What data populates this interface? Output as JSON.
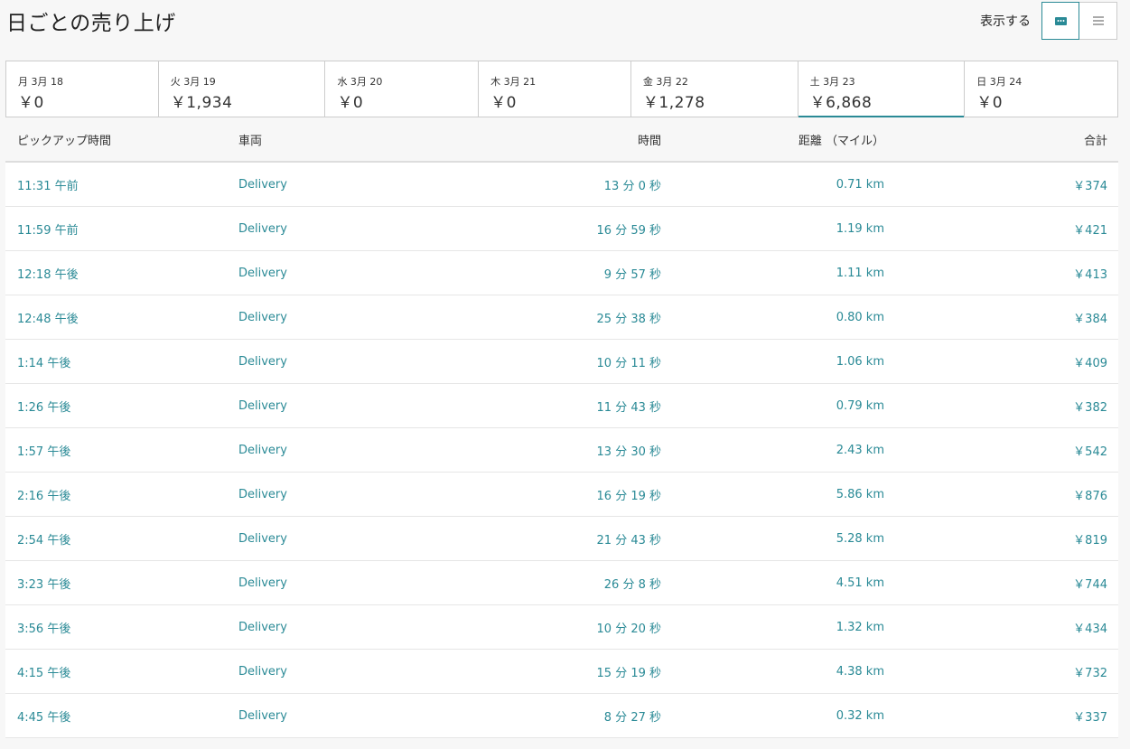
{
  "header": {
    "title": "日ごとの売り上げ",
    "view_label": "表示する",
    "view_options": [
      {
        "icon": "tile-view-icon",
        "active": true
      },
      {
        "icon": "list-view-icon",
        "active": false
      }
    ]
  },
  "days": [
    {
      "label": "月 3月 18",
      "amount": "￥0",
      "width": 169
    },
    {
      "label": "火 3月 19",
      "amount": "￥1,934",
      "width": 185
    },
    {
      "label": "水 3月 20",
      "amount": "￥0",
      "width": 170
    },
    {
      "label": "木 3月 21",
      "amount": "￥0",
      "width": 169
    },
    {
      "label": "金 3月 22",
      "amount": "￥1,278",
      "width": 185
    },
    {
      "label": "土 3月 23",
      "amount": "￥6,868",
      "width": 185,
      "active": true
    },
    {
      "label": "日 3月 24",
      "amount": "￥0",
      "width": 169
    }
  ],
  "table": {
    "headers": [
      "ピックアップ時間",
      "車両",
      "時間",
      "距離 （マイル）",
      "合計"
    ],
    "rows": [
      [
        "11:31 午前",
        "Delivery",
        "13 分 0 秒",
        "0.71 km",
        "￥374"
      ],
      [
        "11:59 午前",
        "Delivery",
        "16 分 59 秒",
        "1.19 km",
        "￥421"
      ],
      [
        "12:18 午後",
        "Delivery",
        "9 分 57 秒",
        "1.11 km",
        "￥413"
      ],
      [
        "12:48 午後",
        "Delivery",
        "25 分 38 秒",
        "0.80 km",
        "￥384"
      ],
      [
        "1:14 午後",
        "Delivery",
        "10 分 11 秒",
        "1.06 km",
        "￥409"
      ],
      [
        "1:26 午後",
        "Delivery",
        "11 分 43 秒",
        "0.79 km",
        "￥382"
      ],
      [
        "1:57 午後",
        "Delivery",
        "13 分 30 秒",
        "2.43 km",
        "￥542"
      ],
      [
        "2:16 午後",
        "Delivery",
        "16 分 19 秒",
        "5.86 km",
        "￥876"
      ],
      [
        "2:54 午後",
        "Delivery",
        "21 分 43 秒",
        "5.28 km",
        "￥819"
      ],
      [
        "3:23 午後",
        "Delivery",
        "26 分 8 秒",
        "4.51 km",
        "￥744"
      ],
      [
        "3:56 午後",
        "Delivery",
        "10 分 20 秒",
        "1.32 km",
        "￥434"
      ],
      [
        "4:15 午後",
        "Delivery",
        "15 分 19 秒",
        "4.38 km",
        "￥732"
      ],
      [
        "4:45 午後",
        "Delivery",
        "8 分 27 秒",
        "0.32 km",
        "￥337"
      ]
    ]
  },
  "colors": {
    "accent": "#2a8a96"
  }
}
